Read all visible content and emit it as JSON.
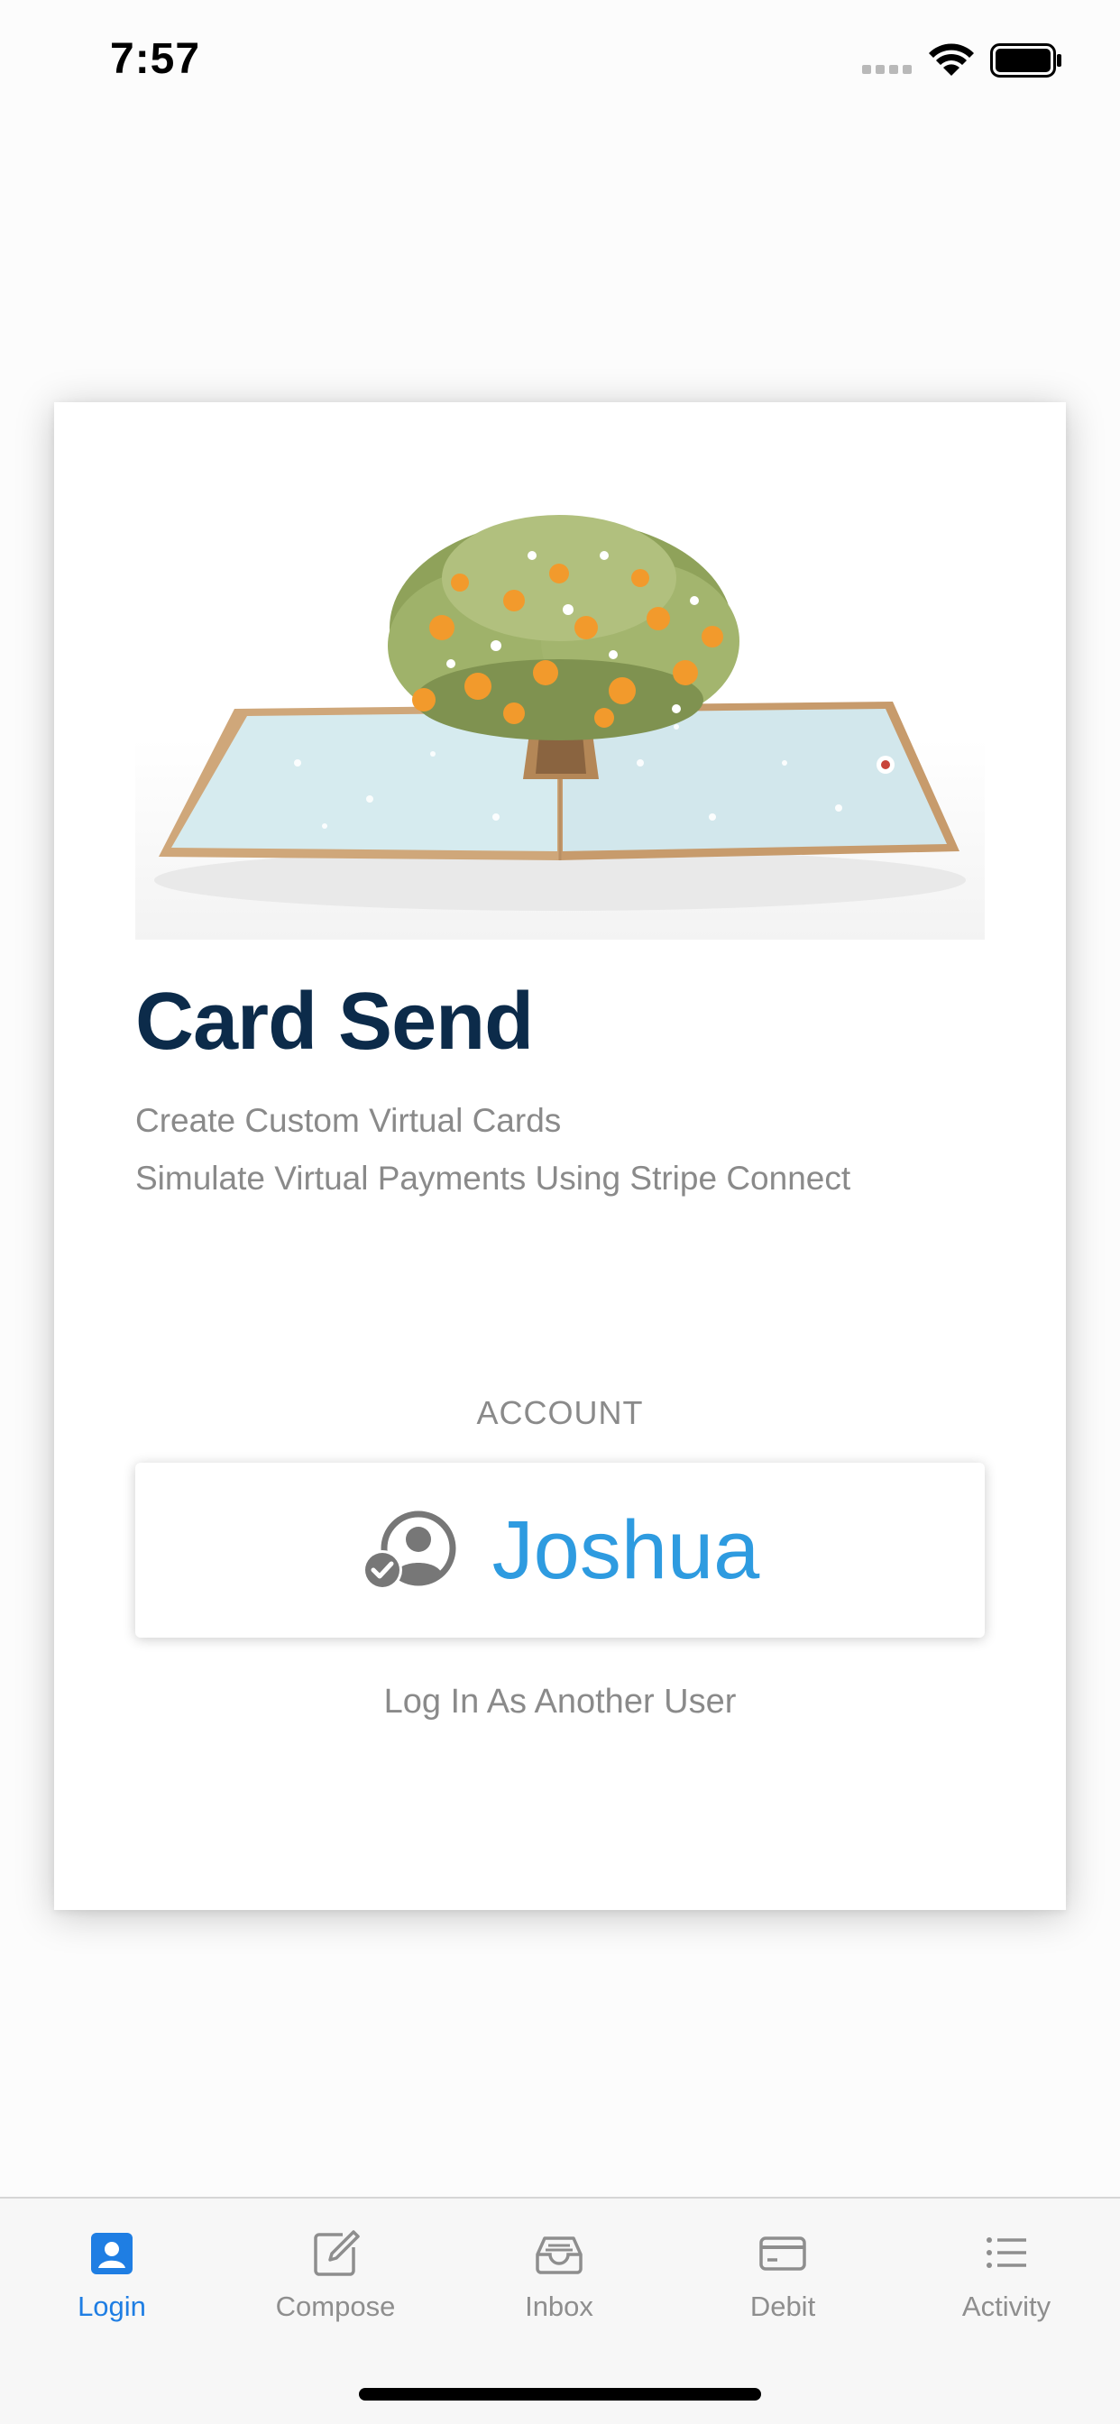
{
  "status_bar": {
    "time": "7:57"
  },
  "card": {
    "image_icon": "pop-up-card-orange-tree",
    "title": "Card Send",
    "subtitle_lines": [
      "Create Custom Virtual Cards",
      "Simulate Virtual Payments Using Stripe Connect"
    ],
    "account_section_label": "ACCOUNT",
    "account": {
      "icon": "user-check-icon",
      "name": "Joshua"
    },
    "switch_user_label": "Log In As Another User"
  },
  "tab_bar": {
    "active_tab": "Login",
    "tabs": [
      {
        "label": "Login",
        "icon": "person-badge-icon"
      },
      {
        "label": "Compose",
        "icon": "compose-icon"
      },
      {
        "label": "Inbox",
        "icon": "inbox-tray-icon"
      },
      {
        "label": "Debit",
        "icon": "credit-card-icon"
      },
      {
        "label": "Activity",
        "icon": "list-icon"
      }
    ]
  },
  "colors": {
    "title": "#0c2b4a",
    "accent": "#2e9be0",
    "tab_active": "#1f7ee3",
    "tab_inactive": "#8e8e8e",
    "secondary_text": "#8a8a8a"
  }
}
